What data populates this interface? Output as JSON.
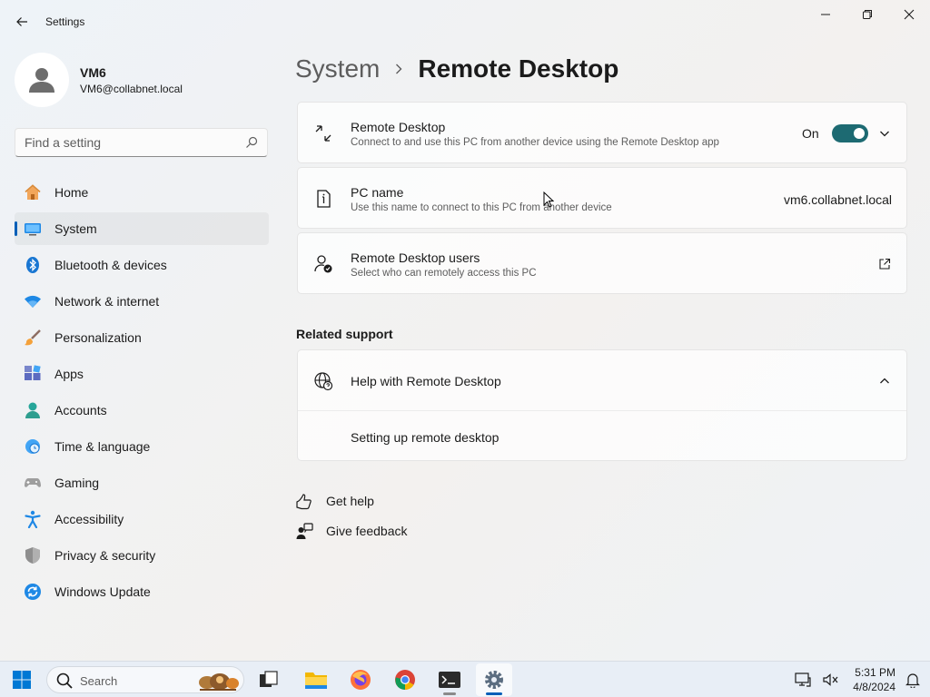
{
  "window": {
    "title": "Settings",
    "controls": [
      "minimize",
      "maximize",
      "close"
    ]
  },
  "profile": {
    "name": "VM6",
    "email": "VM6@collabnet.local"
  },
  "search": {
    "placeholder": "Find a setting"
  },
  "sidebar": {
    "items": [
      {
        "label": "Home",
        "icon": "home-icon"
      },
      {
        "label": "System",
        "icon": "system-icon",
        "selected": true
      },
      {
        "label": "Bluetooth & devices",
        "icon": "bluetooth-icon"
      },
      {
        "label": "Network & internet",
        "icon": "wifi-icon"
      },
      {
        "label": "Personalization",
        "icon": "brush-icon"
      },
      {
        "label": "Apps",
        "icon": "apps-icon"
      },
      {
        "label": "Accounts",
        "icon": "accounts-icon"
      },
      {
        "label": "Time & language",
        "icon": "clock-globe-icon"
      },
      {
        "label": "Gaming",
        "icon": "gamepad-icon"
      },
      {
        "label": "Accessibility",
        "icon": "accessibility-icon"
      },
      {
        "label": "Privacy & security",
        "icon": "shield-icon"
      },
      {
        "label": "Windows Update",
        "icon": "update-icon"
      }
    ]
  },
  "header": {
    "parent": "System",
    "current": "Remote Desktop"
  },
  "cards": {
    "remote_desktop": {
      "title": "Remote Desktop",
      "subtitle": "Connect to and use this PC from another device using the Remote Desktop app",
      "toggle_state": "On"
    },
    "pc_name": {
      "title": "PC name",
      "subtitle": "Use this name to connect to this PC from another device",
      "value": "vm6.collabnet.local"
    },
    "users": {
      "title": "Remote Desktop users",
      "subtitle": "Select who can remotely access this PC"
    }
  },
  "related_support": {
    "heading": "Related support",
    "help_title": "Help with Remote Desktop",
    "help_link": "Setting up remote desktop"
  },
  "links": {
    "get_help": "Get help",
    "give_feedback": "Give feedback"
  },
  "taskbar": {
    "search_label": "Search",
    "time": "5:31 PM",
    "date": "4/8/2024"
  },
  "colors": {
    "accent": "#005fb8",
    "toggle_on": "#1d6a72"
  }
}
